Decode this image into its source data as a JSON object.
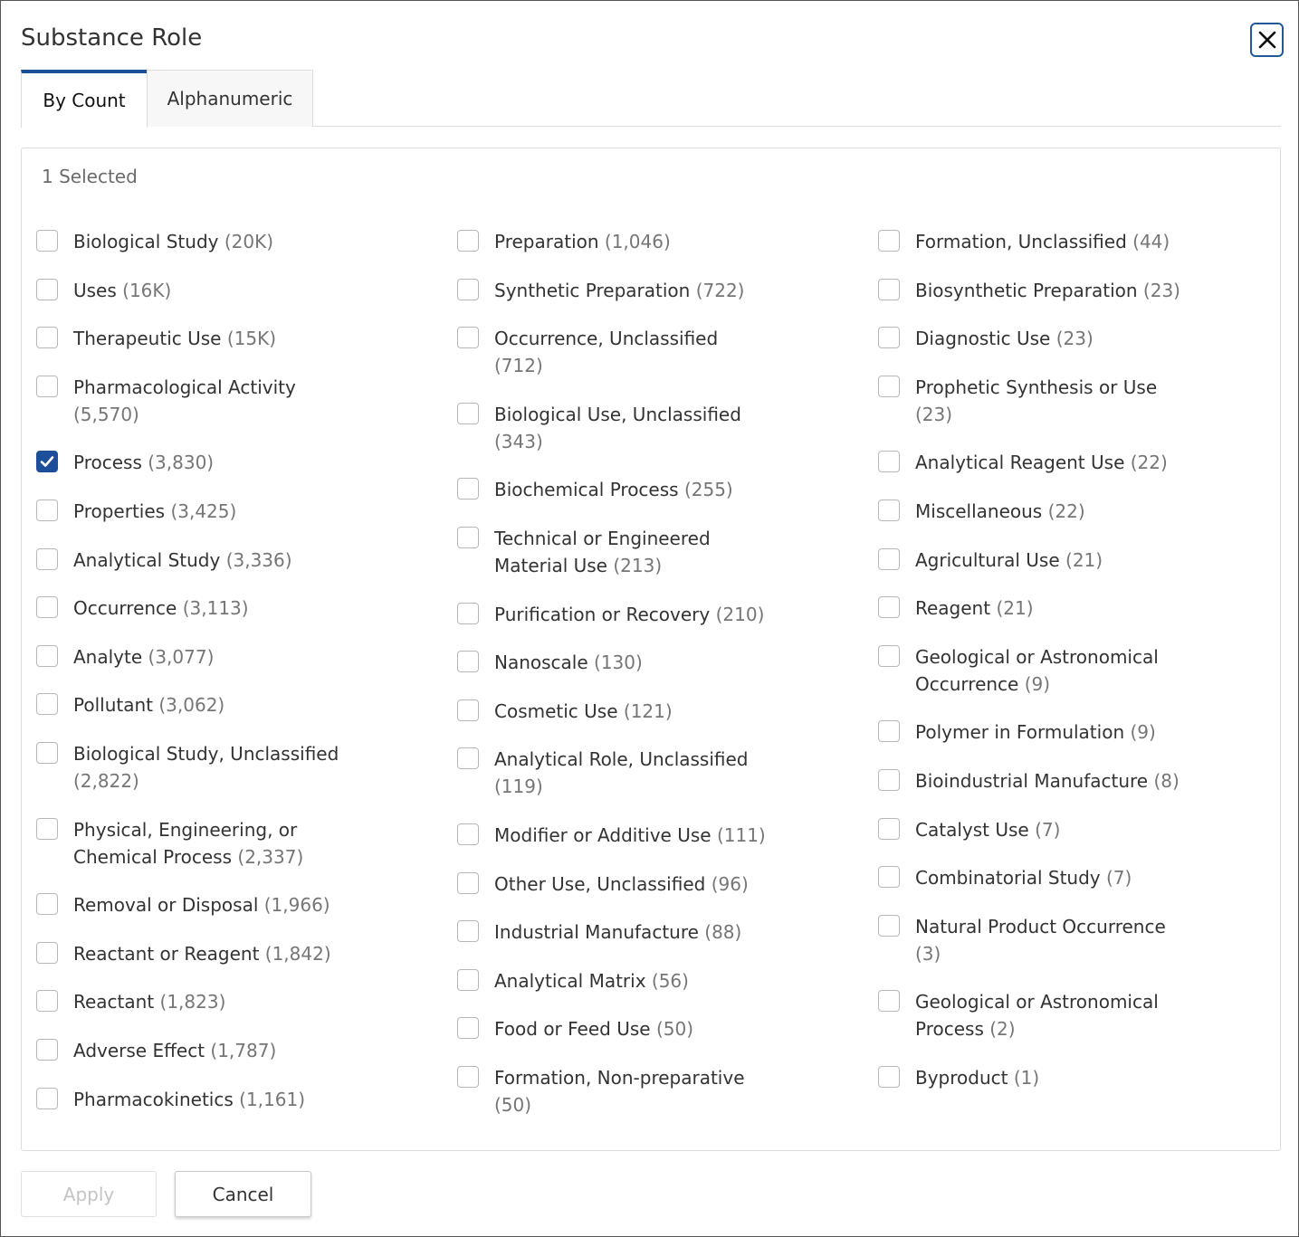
{
  "dialog": {
    "title": "Substance Role"
  },
  "tabs": [
    {
      "label": "By Count",
      "active": true
    },
    {
      "label": "Alphanumeric",
      "active": false
    }
  ],
  "selected_text": "1 Selected",
  "columns": [
    [
      {
        "label": "Biological Study",
        "count": "(20K)",
        "checked": false
      },
      {
        "label": "Uses",
        "count": "(16K)",
        "checked": false
      },
      {
        "label": "Therapeutic Use",
        "count": "(15K)",
        "checked": false
      },
      {
        "label": "Pharmacological Activity",
        "count": "(5,570)",
        "checked": false
      },
      {
        "label": "Process",
        "count": "(3,830)",
        "checked": true
      },
      {
        "label": "Properties",
        "count": "(3,425)",
        "checked": false
      },
      {
        "label": "Analytical Study",
        "count": "(3,336)",
        "checked": false
      },
      {
        "label": "Occurrence",
        "count": "(3,113)",
        "checked": false
      },
      {
        "label": "Analyte",
        "count": "(3,077)",
        "checked": false
      },
      {
        "label": "Pollutant",
        "count": "(3,062)",
        "checked": false
      },
      {
        "label": "Biological Study, Unclassified",
        "count": "(2,822)",
        "checked": false
      },
      {
        "label": "Physical, Engineering, or Chemical Process",
        "count": "(2,337)",
        "checked": false
      },
      {
        "label": "Removal or Disposal",
        "count": "(1,966)",
        "checked": false
      },
      {
        "label": "Reactant or Reagent",
        "count": "(1,842)",
        "checked": false
      },
      {
        "label": "Reactant",
        "count": "(1,823)",
        "checked": false
      },
      {
        "label": "Adverse Effect",
        "count": "(1,787)",
        "checked": false
      },
      {
        "label": "Pharmacokinetics",
        "count": "(1,161)",
        "checked": false
      }
    ],
    [
      {
        "label": "Preparation",
        "count": "(1,046)",
        "checked": false
      },
      {
        "label": "Synthetic Preparation",
        "count": "(722)",
        "checked": false
      },
      {
        "label": "Occurrence, Unclassified",
        "count": "(712)",
        "checked": false
      },
      {
        "label": "Biological Use, Unclassified",
        "count": "(343)",
        "checked": false
      },
      {
        "label": "Biochemical Process",
        "count": "(255)",
        "checked": false
      },
      {
        "label": "Technical or Engineered Material Use",
        "count": "(213)",
        "checked": false
      },
      {
        "label": "Purification or Recovery",
        "count": "(210)",
        "checked": false
      },
      {
        "label": "Nanoscale",
        "count": "(130)",
        "checked": false
      },
      {
        "label": "Cosmetic Use",
        "count": "(121)",
        "checked": false
      },
      {
        "label": "Analytical Role, Unclassified",
        "count": "(119)",
        "checked": false
      },
      {
        "label": "Modifier or Additive Use",
        "count": "(111)",
        "checked": false
      },
      {
        "label": "Other Use, Unclassified",
        "count": "(96)",
        "checked": false
      },
      {
        "label": "Industrial Manufacture",
        "count": "(88)",
        "checked": false
      },
      {
        "label": "Analytical Matrix",
        "count": "(56)",
        "checked": false
      },
      {
        "label": "Food or Feed Use",
        "count": "(50)",
        "checked": false
      },
      {
        "label": "Formation, Non-preparative",
        "count": "(50)",
        "checked": false
      }
    ],
    [
      {
        "label": "Formation, Unclassified",
        "count": "(44)",
        "checked": false
      },
      {
        "label": "Biosynthetic Preparation",
        "count": "(23)",
        "checked": false
      },
      {
        "label": "Diagnostic Use",
        "count": "(23)",
        "checked": false
      },
      {
        "label": "Prophetic Synthesis or Use",
        "count": "(23)",
        "checked": false
      },
      {
        "label": "Analytical Reagent Use",
        "count": "(22)",
        "checked": false
      },
      {
        "label": "Miscellaneous",
        "count": "(22)",
        "checked": false
      },
      {
        "label": "Agricultural Use",
        "count": "(21)",
        "checked": false
      },
      {
        "label": "Reagent",
        "count": "(21)",
        "checked": false
      },
      {
        "label": "Geological or Astronomical Occurrence",
        "count": "(9)",
        "checked": false
      },
      {
        "label": "Polymer in Formulation",
        "count": "(9)",
        "checked": false
      },
      {
        "label": "Bioindustrial Manufacture",
        "count": "(8)",
        "checked": false
      },
      {
        "label": "Catalyst Use",
        "count": "(7)",
        "checked": false
      },
      {
        "label": "Combinatorial Study",
        "count": "(7)",
        "checked": false
      },
      {
        "label": "Natural Product Occurrence",
        "count": "(3)",
        "checked": false
      },
      {
        "label": "Geological or Astronomical Process",
        "count": "(2)",
        "checked": false
      },
      {
        "label": "Byproduct",
        "count": "(1)",
        "checked": false
      }
    ]
  ],
  "footer": {
    "apply_label": "Apply",
    "apply_disabled": true,
    "cancel_label": "Cancel"
  },
  "icons": {
    "close": "close-icon",
    "check": "checkmark-icon"
  },
  "colors": {
    "accent": "#1d4e9a",
    "close_border": "#1f5a96",
    "count_text": "#767676",
    "disabled_text": "#c4c4c4"
  }
}
